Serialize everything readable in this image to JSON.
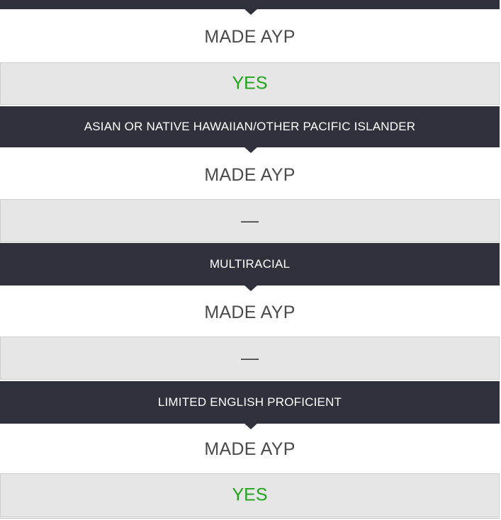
{
  "sections": [
    {
      "header": "",
      "made_label": "MADE AYP",
      "result": "YES",
      "result_type": "yes"
    },
    {
      "header": "ASIAN OR NATIVE HAWAIIAN/OTHER PACIFIC ISLANDER",
      "made_label": "MADE AYP",
      "result": "—",
      "result_type": "dash"
    },
    {
      "header": "MULTIRACIAL",
      "made_label": "MADE AYP",
      "result": "—",
      "result_type": "dash"
    },
    {
      "header": "LIMITED ENGLISH PROFICIENT",
      "made_label": "MADE AYP",
      "result": "YES",
      "result_type": "yes"
    }
  ],
  "colors": {
    "header_bg": "#2f323c",
    "yes": "#21a31c",
    "result_bg": "#e6e6e6"
  }
}
